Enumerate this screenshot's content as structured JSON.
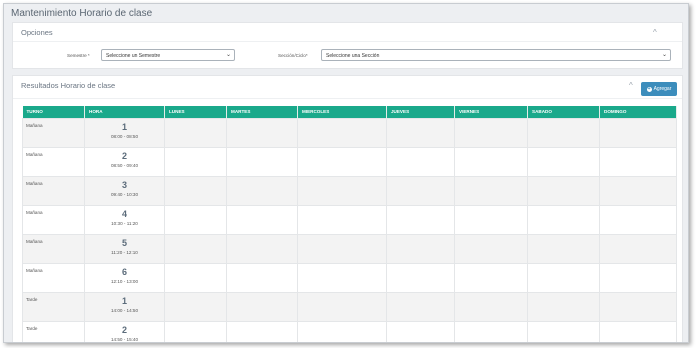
{
  "page": {
    "title": "Mantenimiento Horario de clase"
  },
  "opciones": {
    "title": "Opciones",
    "collapse_symbol": "^",
    "semestre_label": "Semestre *",
    "semestre_value": "Seleccione un Semestre",
    "seccion_label": "Sección/Ciclo*",
    "seccion_value": "Seleccione una Sección",
    "caret": "⌄"
  },
  "resultados": {
    "title": "Resultados Horario de clase",
    "collapse_symbol": "^",
    "add_button_label": "Agregar",
    "add_icon": "plus-circle-icon",
    "columns": [
      "TURNO",
      "HORA",
      "LUNES",
      "MARTES",
      "MIERCOLES",
      "JUEVES",
      "VIERNES",
      "SABADO",
      "DOMINGO"
    ],
    "rows": [
      {
        "turno": "Mañana",
        "num": "1",
        "range": "08:00 - 08:50"
      },
      {
        "turno": "Mañana",
        "num": "2",
        "range": "08:50 - 09:40"
      },
      {
        "turno": "Mañana",
        "num": "3",
        "range": "09:40 - 10:30"
      },
      {
        "turno": "Mañana",
        "num": "4",
        "range": "10:30 - 11:20"
      },
      {
        "turno": "Mañana",
        "num": "5",
        "range": "11:20 - 12:10"
      },
      {
        "turno": "Mañana",
        "num": "6",
        "range": "12:10 - 13:00"
      },
      {
        "turno": "Tarde",
        "num": "1",
        "range": "14:00 - 14:50"
      },
      {
        "turno": "Tarde",
        "num": "2",
        "range": "14:50 - 15:40"
      }
    ]
  },
  "colors": {
    "table_header": "#1aa98b",
    "button": "#3c8dbc"
  }
}
